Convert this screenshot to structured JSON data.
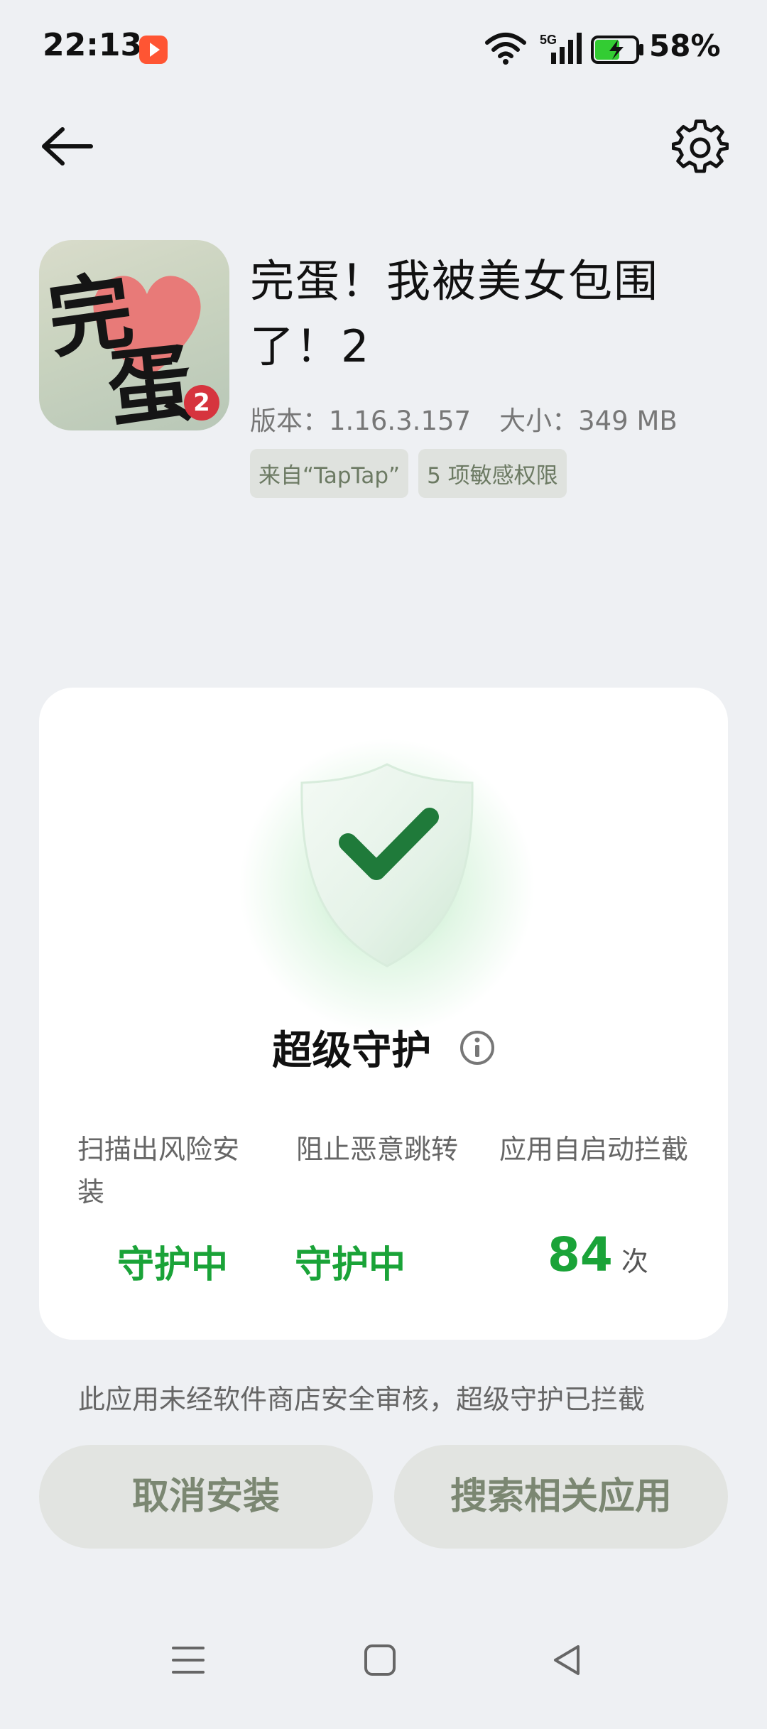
{
  "status_bar": {
    "time": "22:13",
    "network": "5G",
    "battery_percent": "58%",
    "icons": [
      "screen-record-icon",
      "wifi-icon",
      "signal-icon",
      "battery-charging-icon"
    ]
  },
  "header": {
    "back_icon": "arrow-left-icon",
    "settings_icon": "gear-icon"
  },
  "app": {
    "title": "完蛋！我被美女包围了！2",
    "icon_glyph_1": "完",
    "icon_glyph_2": "蛋",
    "icon_badge": "2",
    "version_text": "版本：1.16.3.157",
    "size_text": "大小：349 MB",
    "chips": [
      "来自“TapTap”",
      "5 项敏感权限"
    ]
  },
  "protection": {
    "title": "超级守护",
    "stats": [
      {
        "label": "扫描出风险安装",
        "value": "守护中"
      },
      {
        "label": "阻止恶意跳转",
        "value": "守护中"
      },
      {
        "label": "应用自启动拦截",
        "value": "84",
        "unit": "次"
      }
    ]
  },
  "notice_text": "此应用未经软件商店安全审核，超级守护已拦截",
  "buttons": {
    "cancel": "取消安装",
    "search": "搜索相关应用"
  },
  "colors": {
    "accent_green": "#1aa338",
    "background": "#eef0f3",
    "button_bg": "#e2e4e1",
    "button_text": "#7b8772"
  }
}
